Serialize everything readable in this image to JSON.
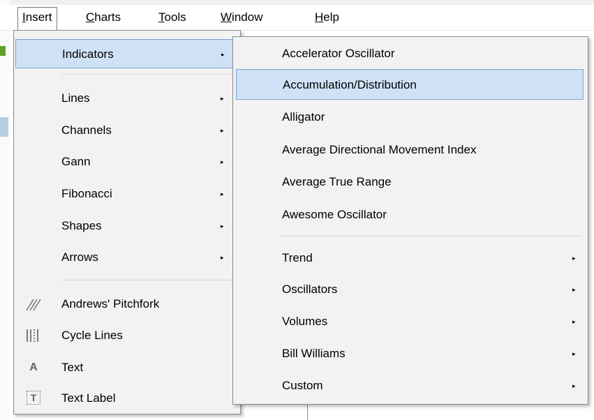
{
  "menubar": {
    "items": [
      {
        "label": "Insert",
        "u": "I",
        "rest": "nsert"
      },
      {
        "label": "Charts",
        "u": "C",
        "rest": "harts"
      },
      {
        "label": "Tools",
        "u": "T",
        "rest": "ools"
      },
      {
        "label": "Window",
        "u": "W",
        "rest": "indow"
      },
      {
        "label": "Help",
        "u": "H",
        "rest": "elp"
      }
    ]
  },
  "insert_menu": {
    "items": [
      {
        "label": "Indicators",
        "has_submenu": true,
        "highlighted": true
      },
      {
        "label": "Lines",
        "has_submenu": true
      },
      {
        "label": "Channels",
        "has_submenu": true
      },
      {
        "label": "Gann",
        "has_submenu": true
      },
      {
        "label": "Fibonacci",
        "has_submenu": true
      },
      {
        "label": "Shapes",
        "has_submenu": true
      },
      {
        "label": "Arrows",
        "has_submenu": true
      },
      {
        "label": "Andrews' Pitchfork",
        "icon": "pitchfork-icon"
      },
      {
        "label": "Cycle Lines",
        "icon": "cycle-lines-icon"
      },
      {
        "label": "Text",
        "icon": "text-icon"
      },
      {
        "label": "Text Label",
        "icon": "text-label-icon"
      }
    ]
  },
  "indicators_submenu": {
    "items": [
      {
        "label": "Accelerator Oscillator"
      },
      {
        "label": "Accumulation/Distribution",
        "highlighted": true
      },
      {
        "label": "Alligator"
      },
      {
        "label": "Average Directional Movement Index"
      },
      {
        "label": "Average True Range"
      },
      {
        "label": "Awesome Oscillator"
      },
      {
        "label": "Trend",
        "has_submenu": true
      },
      {
        "label": "Oscillators",
        "has_submenu": true
      },
      {
        "label": "Volumes",
        "has_submenu": true
      },
      {
        "label": "Bill Williams",
        "has_submenu": true
      },
      {
        "label": "Custom",
        "has_submenu": true
      }
    ]
  },
  "colors": {
    "highlight": "#cfe1f5",
    "highlight_border": "#7ba4d8",
    "menu_bg": "#f2f2f2"
  },
  "glyphs": {
    "arrow": "▸",
    "text_icon": "A",
    "text_label_icon": "T"
  }
}
